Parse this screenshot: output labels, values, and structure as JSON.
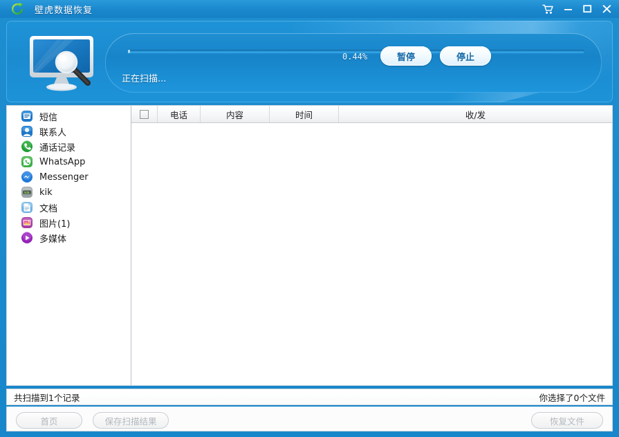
{
  "window": {
    "title": "壁虎数据恢复",
    "logo_icon": "recovery-circular-arrow-icon",
    "controls": {
      "cart": "cart-icon",
      "minimize": "−",
      "maximize": "□",
      "close": "X"
    }
  },
  "banner": {
    "device_icon": "monitor-magnifier-icon",
    "scan_label": "正在扫描...",
    "progress_percent_text": "0.44%",
    "progress_percent_value": 0.44,
    "pause_label": "暂停",
    "stop_label": "停止"
  },
  "sidebar": {
    "items": [
      {
        "label": "短信",
        "icon": "sms-icon"
      },
      {
        "label": "联系人",
        "icon": "contacts-icon"
      },
      {
        "label": "通话记录",
        "icon": "call-log-icon"
      },
      {
        "label": "WhatsApp",
        "icon": "whatsapp-icon"
      },
      {
        "label": "Messenger",
        "icon": "messenger-icon"
      },
      {
        "label": "kik",
        "icon": "kik-icon"
      },
      {
        "label": "文档",
        "icon": "document-icon"
      },
      {
        "label": "图片(1)",
        "icon": "picture-icon"
      },
      {
        "label": "多媒体",
        "icon": "multimedia-icon"
      }
    ]
  },
  "table": {
    "select_all_icon": "checkbox-unchecked-icon",
    "columns": [
      "电话",
      "内容",
      "时间",
      "收/发"
    ],
    "rows": []
  },
  "statusbar": {
    "scan_count_text": "共扫描到1个记录",
    "selected_text": "你选择了0个文件"
  },
  "footer": {
    "home_label": "首页",
    "save_label": "保存扫描结果",
    "recover_label": "恢复文件"
  },
  "colors": {
    "brand_blue": "#1886ca",
    "titlebar_blue": "#1a87cd",
    "banner_blue": "#1b8bd0",
    "button_text_blue": "#1669a8",
    "disabled_text": "#b4b9bd"
  }
}
